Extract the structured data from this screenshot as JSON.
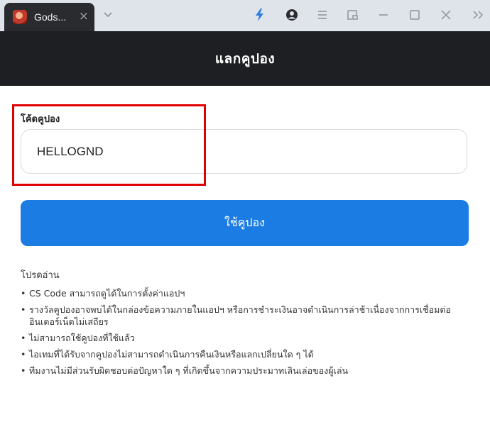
{
  "browser": {
    "tab_title": "Gods...",
    "tab_close": "×"
  },
  "header": {
    "title": "แลกคูปอง"
  },
  "form": {
    "label": "โค้ดคูปอง",
    "code_value": "HELLOGND",
    "button_label": "ใช้คูปอง"
  },
  "notes": {
    "title": "โปรดอ่าน",
    "items": [
      "CS Code สามารถดูได้ในการตั้งค่าแอปฯ",
      "รางวัลคูปองอาจพบได้ในกล่องข้อความภายในแอปฯ หรือการชำระเงินอาจดำเนินการล่าช้าเนื่องจากการเชื่อมต่ออินเตอร์เน็ตไม่เสถียร",
      "ไม่สามารถใช้คูปองที่ใช้แล้ว",
      "ไอเทมที่ได้รับจากคูปองไม่สามารถดำเนินการคืนเงินหรือแลกเปลี่ยนใด ๆ ได้",
      "ทีมงานไม่มีส่วนรับผิดชอบต่อปัญหาใด ๆ ที่เกิดขึ้นจากความประมาทเลินเล่อของผู้เล่น"
    ]
  },
  "colors": {
    "header_bg": "#1d1f22",
    "button_bg": "#1b7ce4",
    "highlight": "#e00000"
  },
  "icons": [
    "app-favicon",
    "chevron-down-icon",
    "lightning-icon",
    "account-icon",
    "menu-icon",
    "pip-icon",
    "minimize-icon",
    "maximize-icon",
    "close-icon",
    "expand-icon"
  ]
}
